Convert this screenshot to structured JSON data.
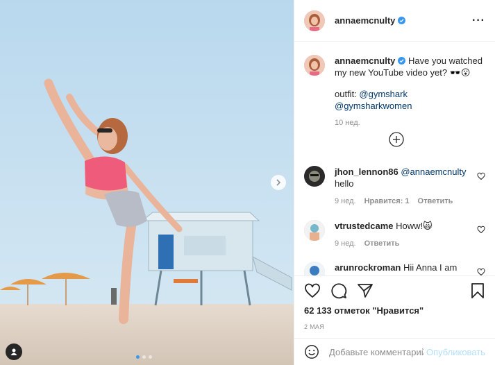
{
  "post": {
    "header": {
      "username": "annaemcnulty"
    },
    "caption": {
      "username": "annaemcnulty",
      "text": "Have you watched my new YouTube video yet? 🕶️😮",
      "outfit_label": "outfit:",
      "mention1": "@gymshark",
      "mention2": "@gymsharkwomen",
      "time": "10 нед."
    },
    "comments": [
      {
        "username": "jhon_lennon86",
        "mention": "@annaemcnulty",
        "text": "hello",
        "time": "9 нед.",
        "likes": "Нравится: 1",
        "reply": "Ответить"
      },
      {
        "username": "vtrustedcame",
        "text": "Howw!🙀",
        "time": "9 нед.",
        "reply": "Ответить"
      },
      {
        "username": "arunrockroman",
        "text": "Hii Anna I am"
      }
    ],
    "likes_text": "62 133 отметок \"Нравится\"",
    "date": "2 МАЯ",
    "add_comment": {
      "placeholder": "Добавьте комментарий...",
      "post_label": "Опубликовать"
    }
  },
  "colors": {
    "accent": "#3897f0",
    "link": "#00376b",
    "muted": "#8e8e8e",
    "post_disabled": "#b2dffc"
  }
}
